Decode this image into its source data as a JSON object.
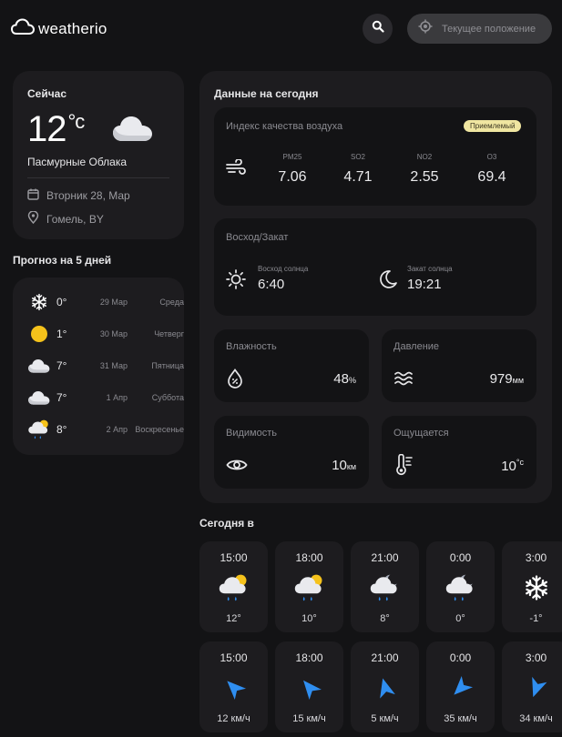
{
  "app": {
    "name": "weatherio"
  },
  "header": {
    "location_button_label": "Текущее положение"
  },
  "now": {
    "title": "Сейчас",
    "temp": "12",
    "unit": "°c",
    "condition": "Пасмурные Облака",
    "date": "Вторник 28, Мар",
    "location": "Гомель, BY"
  },
  "forecast": {
    "title": "Прогноз на 5 дней",
    "days": [
      {
        "icon": "snowflake-icon",
        "temp": "0°",
        "date": "29 Мар",
        "day": "Среда"
      },
      {
        "icon": "sun-icon",
        "temp": "1°",
        "date": "30 Мар",
        "day": "Четверг"
      },
      {
        "icon": "cloud-icon",
        "temp": "7°",
        "date": "31 Мар",
        "day": "Пятница"
      },
      {
        "icon": "cloud-icon",
        "temp": "7°",
        "date": "1 Апр",
        "day": "Суббота"
      },
      {
        "icon": "sun-rain-cloud-icon",
        "temp": "8°",
        "date": "2 Апр",
        "day": "Воскресенье"
      }
    ]
  },
  "today": {
    "title": "Данные на сегодня",
    "air_quality": {
      "label": "Индекс качества воздуха",
      "badge": "Приемлемый",
      "items": [
        {
          "key": "PM25",
          "value": "7.06"
        },
        {
          "key": "SO2",
          "value": "4.71"
        },
        {
          "key": "NO2",
          "value": "2.55"
        },
        {
          "key": "O3",
          "value": "69.4"
        }
      ]
    },
    "sun": {
      "label": "Восход/Закат",
      "sunrise_label": "Восход солнца",
      "sunrise": "6:40",
      "sunset_label": "Закат солнца",
      "sunset": "19:21"
    },
    "humidity": {
      "label": "Влажность",
      "value": "48",
      "unit": "%"
    },
    "pressure": {
      "label": "Давление",
      "value": "979",
      "unit": "мм"
    },
    "visibility": {
      "label": "Видимость",
      "value": "10",
      "unit": "км"
    },
    "feels_like": {
      "label": "Ощущается",
      "value": "10",
      "unit": "°c"
    }
  },
  "hourly": {
    "title": "Сегодня в",
    "temps": [
      {
        "time": "15:00",
        "icon": "sun-rain-cloud-icon",
        "value": "12°"
      },
      {
        "time": "18:00",
        "icon": "sun-rain-cloud-icon",
        "value": "10°"
      },
      {
        "time": "21:00",
        "icon": "moon-rain-cloud-icon",
        "value": "8°"
      },
      {
        "time": "0:00",
        "icon": "moon-rain-cloud-icon",
        "value": "0°"
      },
      {
        "time": "3:00",
        "icon": "snowflake-icon",
        "value": "-1°"
      }
    ],
    "wind": [
      {
        "time": "15:00",
        "direction_deg": 315,
        "value": "12 км/ч"
      },
      {
        "time": "18:00",
        "direction_deg": 320,
        "value": "15 км/ч"
      },
      {
        "time": "21:00",
        "direction_deg": 345,
        "value": "5 км/ч"
      },
      {
        "time": "0:00",
        "direction_deg": 225,
        "value": "35 км/ч"
      },
      {
        "time": "3:00",
        "direction_deg": 200,
        "value": "34 км/ч"
      }
    ]
  },
  "colors": {
    "accent_blue": "#2f8ef0",
    "sun_yellow": "#f5c21b",
    "badge_bg": "#f0e6a1",
    "background": "#131315",
    "card": "#1d1c1f"
  }
}
